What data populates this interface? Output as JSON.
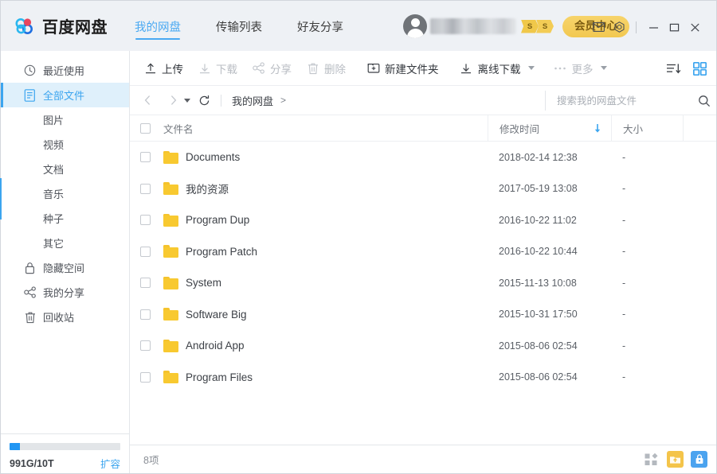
{
  "app": {
    "logo_text": "百度网盘",
    "logo_icon": "baidu-cloud-logo"
  },
  "nav_tabs": [
    {
      "label": "我的网盘",
      "active": true
    },
    {
      "label": "传输列表",
      "active": false
    },
    {
      "label": "好友分享",
      "active": false
    }
  ],
  "user": {
    "avatar_icon": "user-avatar-icon",
    "username": "",
    "username_redacted": true,
    "badges": [
      "S",
      "S"
    ],
    "vip_label": "会员中心"
  },
  "window_controls": {
    "mail_icon": "mail-icon",
    "settings_icon": "settings-gear-icon",
    "minimize": "—",
    "maximize": "▢",
    "close": "✕"
  },
  "sidebar": {
    "items": [
      {
        "label": "最近使用",
        "icon": "clock-icon",
        "active": false,
        "sub": false
      },
      {
        "label": "全部文件",
        "icon": "file-list-icon",
        "active": true,
        "sub": false
      },
      {
        "label": "图片",
        "icon": "",
        "active": false,
        "sub": true
      },
      {
        "label": "视频",
        "icon": "",
        "active": false,
        "sub": true
      },
      {
        "label": "文档",
        "icon": "",
        "active": false,
        "sub": true
      },
      {
        "label": "音乐",
        "icon": "",
        "active": false,
        "sub": true
      },
      {
        "label": "种子",
        "icon": "",
        "active": false,
        "sub": true
      },
      {
        "label": "其它",
        "icon": "",
        "active": false,
        "sub": true
      },
      {
        "label": "隐藏空间",
        "icon": "lock-icon",
        "active": false,
        "sub": false
      },
      {
        "label": "我的分享",
        "icon": "share-icon",
        "active": false,
        "sub": false
      },
      {
        "label": "回收站",
        "icon": "trash-icon",
        "active": false,
        "sub": false
      }
    ],
    "storage": {
      "text": "991G/10T",
      "expand_label": "扩容",
      "used_percent": 9.7,
      "bar_color": "#2196f3"
    }
  },
  "toolbar": {
    "buttons": [
      {
        "label": "上传",
        "icon": "upload-icon",
        "disabled": false,
        "dropdown": false
      },
      {
        "label": "下载",
        "icon": "download-icon",
        "disabled": true,
        "dropdown": false
      },
      {
        "label": "分享",
        "icon": "share-icon",
        "disabled": true,
        "dropdown": false
      },
      {
        "label": "删除",
        "icon": "trash-icon",
        "disabled": true,
        "dropdown": false
      },
      {
        "label": "新建文件夹",
        "icon": "new-folder-icon",
        "disabled": false,
        "dropdown": false
      },
      {
        "label": "离线下载",
        "icon": "offline-download-icon",
        "disabled": false,
        "dropdown": true
      },
      {
        "label": "更多",
        "icon": "more-dots-icon",
        "disabled": true,
        "dropdown": true
      }
    ],
    "sort_icon": "sort-descending-icon",
    "grid_view_icon": "grid-view-icon"
  },
  "breadcrumb": {
    "back_icon": "chevron-left-icon",
    "forward_icon": "chevron-right-icon",
    "history_caret": "caret-down-icon",
    "refresh_icon": "refresh-icon",
    "path": [
      {
        "label": "我的网盘"
      }
    ],
    "separator": ">"
  },
  "search": {
    "placeholder": "搜索我的网盘文件",
    "value": "",
    "icon": "search-icon"
  },
  "table": {
    "headers": {
      "name": "文件名",
      "time": "修改时间",
      "size": "大小"
    },
    "sort_column": "修改时间",
    "sort_direction": "desc",
    "rows": [
      {
        "name": "Documents",
        "time": "2018-02-14 12:38",
        "size": "-",
        "type": "folder"
      },
      {
        "name": "我的资源",
        "time": "2017-05-19 13:08",
        "size": "-",
        "type": "folder"
      },
      {
        "name": "Program Dup",
        "time": "2016-10-22 11:02",
        "size": "-",
        "type": "folder"
      },
      {
        "name": "Program Patch",
        "time": "2016-10-22 10:44",
        "size": "-",
        "type": "folder"
      },
      {
        "name": "System",
        "time": "2015-11-13 10:08",
        "size": "-",
        "type": "folder"
      },
      {
        "name": "Software Big",
        "time": "2015-10-31 17:50",
        "size": "-",
        "type": "folder"
      },
      {
        "name": "Android App",
        "time": "2015-08-06 02:54",
        "size": "-",
        "type": "folder"
      },
      {
        "name": "Program Files",
        "time": "2015-08-06 02:54",
        "size": "-",
        "type": "folder"
      }
    ]
  },
  "statusbar": {
    "count_label": "8项",
    "icons": [
      {
        "name": "apps-grid-icon",
        "color": "#b4b9bf"
      },
      {
        "name": "upload-folder-icon",
        "color": "#f4c44a"
      },
      {
        "name": "lock-icon",
        "color": "#4ba3ef"
      }
    ]
  },
  "colors": {
    "accent": "#3ca5ef",
    "titlebar_bg": "#eef1f5",
    "folder": "#f8c930",
    "vip_gold": "#f2c851"
  }
}
